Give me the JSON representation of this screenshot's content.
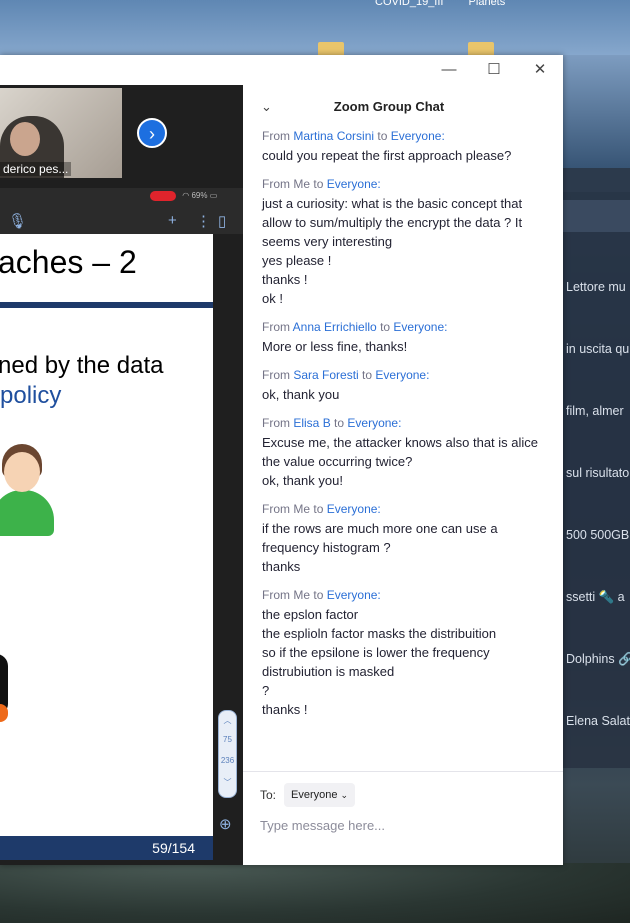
{
  "desktop": {
    "top_labels": [
      "COVID_19_III",
      "Planets"
    ],
    "background_items": [
      "Lettore mu",
      "in uscita qu",
      "film, almer",
      "sul risultato",
      "500 500GB C",
      "ssetti 🔦 a",
      "Dolphins 🔗",
      "Elena Salat"
    ]
  },
  "window": {
    "controls": {
      "minimize": "—",
      "maximize": "☐",
      "close": "✕"
    }
  },
  "meeting": {
    "participant_name": "derico pes...",
    "next_icon": "chevron-right-icon",
    "status_text": "69%",
    "slide": {
      "title": "aches – 2",
      "line1": "ned by the data",
      "line2": "policy",
      "page": "59/154"
    },
    "scroll_numbers": [
      "75",
      "236"
    ]
  },
  "chat": {
    "title": "Zoom Group Chat",
    "messages": [
      {
        "from": "Martina Corsini",
        "to": "Everyone:",
        "lines": [
          "could you repeat the first approach please?"
        ]
      },
      {
        "from": "Me",
        "to": "Everyone:",
        "lines": [
          "just a curiosity: what is the basic concept that allow to sum/multiply the encrypt the data ? It seems very interesting",
          "yes please !",
          "thanks !",
          "ok !"
        ]
      },
      {
        "from": "Anna Errichiello",
        "to": "Everyone:",
        "lines": [
          "More or less fine, thanks!"
        ]
      },
      {
        "from": "Sara Foresti",
        "to": "Everyone:",
        "lines": [
          "ok, thank you"
        ]
      },
      {
        "from": "Elisa B",
        "to": "Everyone:",
        "lines": [
          "Excuse me, the attacker knows also that is alice the value occurring twice?",
          "ok, thank you!"
        ]
      },
      {
        "from": "Me",
        "to": "Everyone:",
        "lines": [
          "if the rows are much more one can use a frequency histogram ?",
          "thanks"
        ]
      },
      {
        "from": "Me",
        "to": "Everyone:",
        "lines": [
          "the epslon factor",
          "the esplioln factor masks the distribuition",
          "so if the epsilone is lower the frequency distrubiution is masked",
          "?",
          "thanks !"
        ]
      }
    ],
    "to_label": "To:",
    "recipient": "Everyone",
    "input_placeholder": "Type message here...",
    "from_word": "From",
    "to_word": "to"
  },
  "colors": {
    "accent": "#2b6fd6",
    "slide_bar": "#1e3a6a",
    "record": "#e0242c"
  }
}
